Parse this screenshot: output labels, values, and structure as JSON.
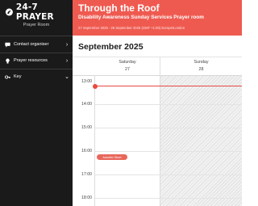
{
  "sidebar": {
    "brand": "24-7 PRAYER",
    "subtitle": "Prayer Room",
    "items": [
      {
        "label": "Contact organiser",
        "icon": "chat-icon"
      },
      {
        "label": "Prayer resources",
        "icon": "lightbulb-icon"
      },
      {
        "label": "Key",
        "icon": "key-icon"
      }
    ]
  },
  "header": {
    "title": "Through the Roof",
    "subtitle": "Disability Awareness Sunday Services Prayer room",
    "dates": "27 September 2025 - 28 September 2025 (GMT +1:00) Europe/London"
  },
  "calendar": {
    "month": "September 2025",
    "days": [
      {
        "name": "Saturday",
        "num": "27"
      },
      {
        "name": "Sunday",
        "num": "28"
      }
    ],
    "times": [
      "13:00",
      "14:00",
      "15:00",
      "16:00",
      "17:00",
      "18:00"
    ],
    "slot_badge": "Annette Short"
  },
  "colors": {
    "sidebar_bg": "#1a1a1a",
    "accent": "#ef5a50",
    "now_line": "#e84a3f"
  }
}
